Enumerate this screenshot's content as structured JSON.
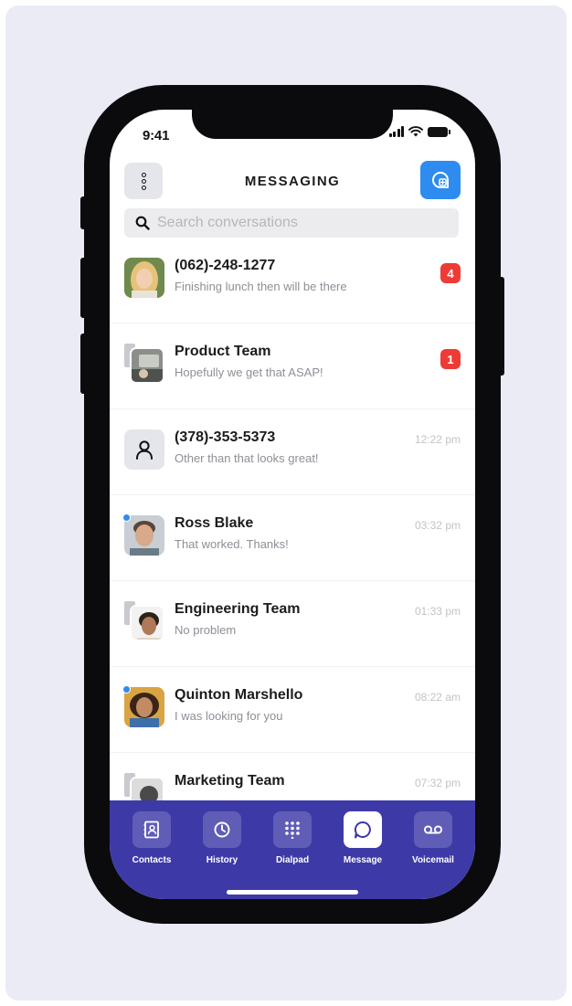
{
  "status_bar": {
    "time": "9:41"
  },
  "header": {
    "title": "MESSAGING"
  },
  "search": {
    "placeholder": "Search conversations",
    "value": ""
  },
  "conversations": [
    {
      "name": "(062)-248-1277",
      "preview": "Finishing lunch then will be there",
      "time": "",
      "badge": "4",
      "avatar": "photo-woman-blonde",
      "group": false,
      "online": false
    },
    {
      "name": "Product Team",
      "preview": "Hopefully we get that ASAP!",
      "time": "",
      "badge": "1",
      "avatar": "photo-group",
      "group": true,
      "online": false
    },
    {
      "name": "(378)-353-5373",
      "preview": "Other than that looks great!",
      "time": "12:22 pm",
      "badge": "",
      "avatar": "user-icon",
      "group": false,
      "online": false
    },
    {
      "name": "Ross Blake",
      "preview": "That worked. Thanks!",
      "time": "03:32 pm",
      "badge": "",
      "avatar": "photo-man",
      "group": false,
      "online": true
    },
    {
      "name": "Engineering Team",
      "preview": "No problem",
      "time": "01:33 pm",
      "badge": "",
      "avatar": "photo-group",
      "group": true,
      "online": false
    },
    {
      "name": "Quinton Marshello",
      "preview": "I was looking for you",
      "time": "08:22 am",
      "badge": "",
      "avatar": "photo-woman-dark",
      "group": false,
      "online": true
    },
    {
      "name": "Marketing Team",
      "preview": "",
      "time": "07:32 pm",
      "badge": "",
      "avatar": "photo-group",
      "group": true,
      "online": false
    }
  ],
  "nav": [
    {
      "label": "Contacts",
      "icon": "contacts-icon",
      "active": false
    },
    {
      "label": "History",
      "icon": "clock-icon",
      "active": false
    },
    {
      "label": "Dialpad",
      "icon": "dialpad-icon",
      "active": false
    },
    {
      "label": "Message",
      "icon": "message-icon",
      "active": true
    },
    {
      "label": "Voicemail",
      "icon": "voicemail-icon",
      "active": false
    }
  ],
  "colors": {
    "accent": "#2e8cf0",
    "nav_background": "#3d3aa8",
    "badge": "#ee3b36",
    "background": "#ebebf5"
  }
}
